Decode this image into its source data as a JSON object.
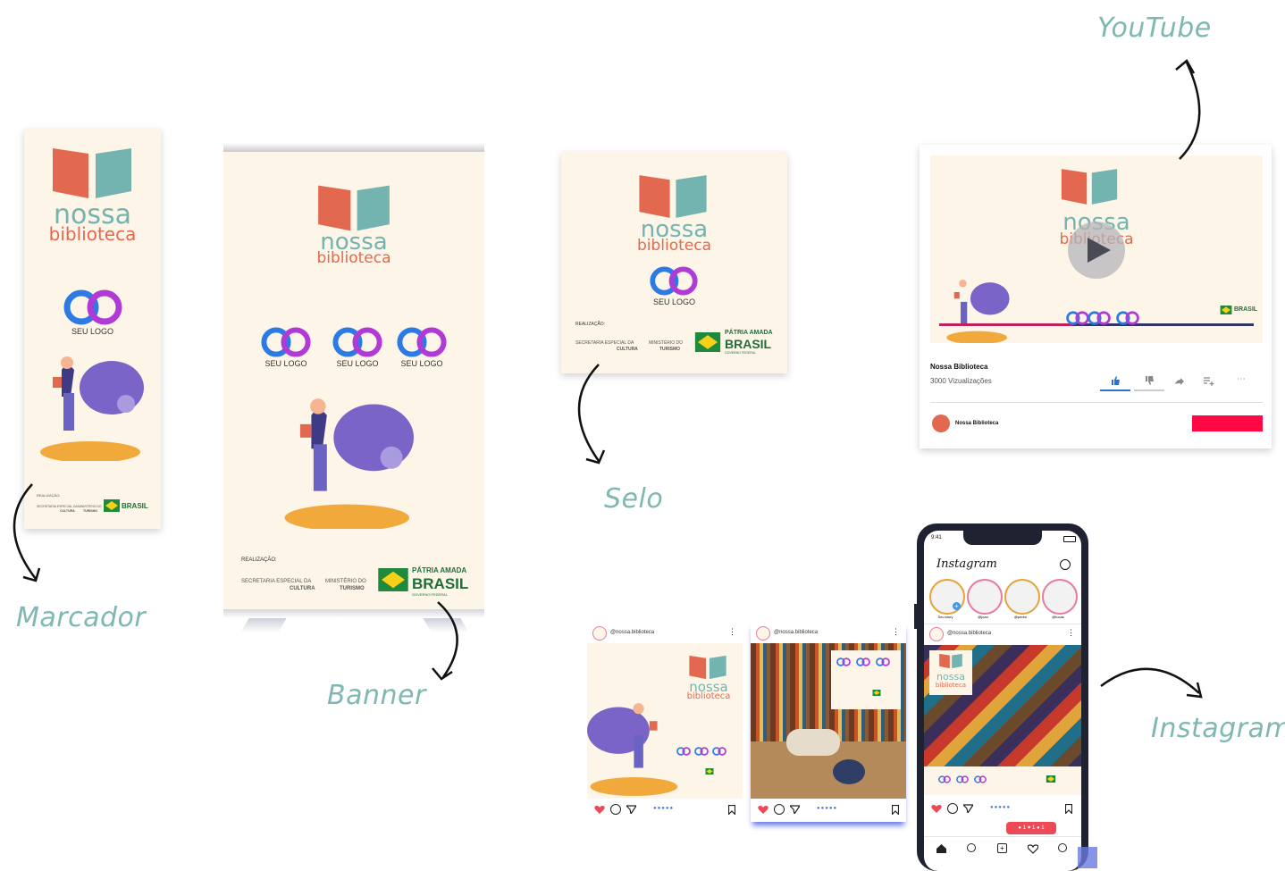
{
  "labels": {
    "youtube": "YouTube",
    "selo": "Selo",
    "marcador": "Marcador",
    "banner": "Banner",
    "instagram": "Instagram"
  },
  "brand": {
    "word1": "nossa",
    "word2": "biblioteca",
    "seu_logo": "SEU LOGO",
    "realizacao": "REALIZAÇÃO:",
    "secretaria": "SECRETARIA ESPECIAL DA",
    "cultura": "CULTURA",
    "ministerio": "MINISTÉRIO DO",
    "turismo": "TURISMO",
    "patria": "PÁTRIA AMADA",
    "brasil": "BRASIL",
    "governo": "GOVERNO FEDERAL",
    "colors": {
      "teal": "#74b4b0",
      "coral": "#e2694f",
      "cream": "#fdf5e7",
      "purple": "#7a64c8",
      "brasil_green": "#1f8a3e",
      "yt_red": "#ff0844"
    }
  },
  "youtube": {
    "title": "Nossa Biblioteca",
    "views": "3000 Vizualizações",
    "channel": "Nossa Biblioteca"
  },
  "instagram": {
    "app_title": "Instagram",
    "status_time": "9:41",
    "stories": [
      "Seu story",
      "@joao",
      "@pedro",
      "@lucas"
    ],
    "post_handle": "@nossa.biblioteca",
    "notif": {
      "comments": "1",
      "likes": "1",
      "follows": "1"
    }
  }
}
